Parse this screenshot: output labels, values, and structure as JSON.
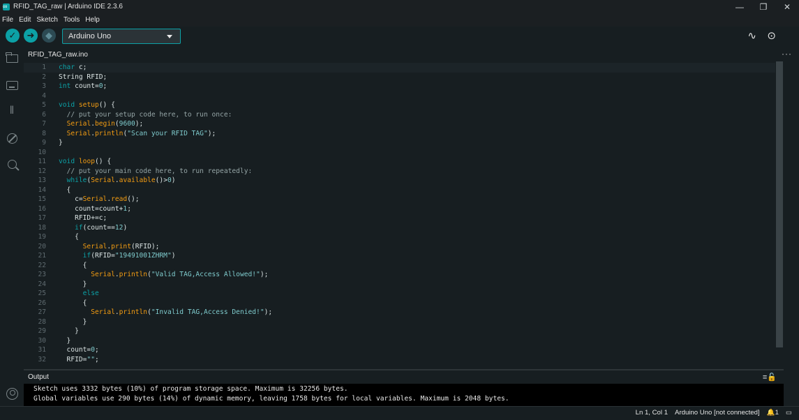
{
  "window": {
    "title": "RFID_TAG_raw | Arduino IDE 2.3.6",
    "controls": [
      "—",
      "❐",
      "✕"
    ]
  },
  "menu": [
    "File",
    "Edit",
    "Sketch",
    "Tools",
    "Help"
  ],
  "toolbar": {
    "verify_icon": "✓",
    "upload_icon": "➜",
    "debug_icon": "◆",
    "board": "Arduino Uno",
    "plotter_icon": "∿",
    "monitor_icon": "⊙"
  },
  "tab": {
    "filename": "RFID_TAG_raw.ino",
    "more": "···"
  },
  "code_lines": [
    {
      "n": "1",
      "tokens": [
        {
          "t": "kw",
          "v": "char"
        },
        {
          "t": "",
          "v": " c;"
        }
      ]
    },
    {
      "n": "2",
      "tokens": [
        {
          "t": "",
          "v": "String RFID;"
        }
      ]
    },
    {
      "n": "3",
      "tokens": [
        {
          "t": "kw",
          "v": "int"
        },
        {
          "t": "",
          "v": " count="
        },
        {
          "t": "num",
          "v": "0"
        },
        {
          "t": "",
          "v": ";"
        }
      ]
    },
    {
      "n": "4",
      "tokens": []
    },
    {
      "n": "5",
      "tokens": [
        {
          "t": "kw",
          "v": "void"
        },
        {
          "t": "",
          "v": " "
        },
        {
          "t": "fn",
          "v": "setup"
        },
        {
          "t": "",
          "v": "() {"
        }
      ]
    },
    {
      "n": "6",
      "tokens": [
        {
          "t": "",
          "v": "  "
        },
        {
          "t": "cm",
          "v": "// put your setup code here, to run once:"
        }
      ]
    },
    {
      "n": "7",
      "tokens": [
        {
          "t": "",
          "v": "  "
        },
        {
          "t": "fn",
          "v": "Serial"
        },
        {
          "t": "",
          "v": "."
        },
        {
          "t": "fn",
          "v": "begin"
        },
        {
          "t": "",
          "v": "("
        },
        {
          "t": "num",
          "v": "9600"
        },
        {
          "t": "",
          "v": ");"
        }
      ]
    },
    {
      "n": "8",
      "tokens": [
        {
          "t": "",
          "v": "  "
        },
        {
          "t": "fn",
          "v": "Serial"
        },
        {
          "t": "",
          "v": "."
        },
        {
          "t": "fn",
          "v": "println"
        },
        {
          "t": "",
          "v": "("
        },
        {
          "t": "str",
          "v": "\"Scan your RFID TAG\""
        },
        {
          "t": "",
          "v": ");"
        }
      ]
    },
    {
      "n": "9",
      "tokens": [
        {
          "t": "",
          "v": "}"
        }
      ]
    },
    {
      "n": "10",
      "tokens": []
    },
    {
      "n": "11",
      "tokens": [
        {
          "t": "kw",
          "v": "void"
        },
        {
          "t": "",
          "v": " "
        },
        {
          "t": "fn",
          "v": "loop"
        },
        {
          "t": "",
          "v": "() {"
        }
      ]
    },
    {
      "n": "12",
      "tokens": [
        {
          "t": "",
          "v": "  "
        },
        {
          "t": "cm",
          "v": "// put your main code here, to run repeatedly:"
        }
      ]
    },
    {
      "n": "13",
      "tokens": [
        {
          "t": "",
          "v": "  "
        },
        {
          "t": "kw",
          "v": "while"
        },
        {
          "t": "",
          "v": "("
        },
        {
          "t": "fn",
          "v": "Serial"
        },
        {
          "t": "",
          "v": "."
        },
        {
          "t": "fn",
          "v": "available"
        },
        {
          "t": "",
          "v": "()>"
        },
        {
          "t": "num",
          "v": "0"
        },
        {
          "t": "",
          "v": ")"
        }
      ]
    },
    {
      "n": "14",
      "tokens": [
        {
          "t": "",
          "v": "  {"
        }
      ]
    },
    {
      "n": "15",
      "tokens": [
        {
          "t": "",
          "v": "    c="
        },
        {
          "t": "fn",
          "v": "Serial"
        },
        {
          "t": "",
          "v": "."
        },
        {
          "t": "fn",
          "v": "read"
        },
        {
          "t": "",
          "v": "();"
        }
      ]
    },
    {
      "n": "16",
      "tokens": [
        {
          "t": "",
          "v": "    count=count+"
        },
        {
          "t": "num",
          "v": "1"
        },
        {
          "t": "",
          "v": ";"
        }
      ]
    },
    {
      "n": "17",
      "tokens": [
        {
          "t": "",
          "v": "    RFID+=c;"
        }
      ]
    },
    {
      "n": "18",
      "tokens": [
        {
          "t": "",
          "v": "    "
        },
        {
          "t": "kw",
          "v": "if"
        },
        {
          "t": "",
          "v": "(count=="
        },
        {
          "t": "num",
          "v": "12"
        },
        {
          "t": "",
          "v": ")"
        }
      ]
    },
    {
      "n": "19",
      "tokens": [
        {
          "t": "",
          "v": "    {"
        }
      ]
    },
    {
      "n": "20",
      "tokens": [
        {
          "t": "",
          "v": "      "
        },
        {
          "t": "fn",
          "v": "Serial"
        },
        {
          "t": "",
          "v": "."
        },
        {
          "t": "fn",
          "v": "print"
        },
        {
          "t": "",
          "v": "(RFID);"
        }
      ]
    },
    {
      "n": "21",
      "tokens": [
        {
          "t": "",
          "v": "      "
        },
        {
          "t": "kw",
          "v": "if"
        },
        {
          "t": "",
          "v": "(RFID="
        },
        {
          "t": "str",
          "v": "\"19491001ZHRM\""
        },
        {
          "t": "",
          "v": ")"
        }
      ]
    },
    {
      "n": "22",
      "tokens": [
        {
          "t": "",
          "v": "      {"
        }
      ]
    },
    {
      "n": "23",
      "tokens": [
        {
          "t": "",
          "v": "        "
        },
        {
          "t": "fn",
          "v": "Serial"
        },
        {
          "t": "",
          "v": "."
        },
        {
          "t": "fn",
          "v": "println"
        },
        {
          "t": "",
          "v": "("
        },
        {
          "t": "str",
          "v": "\"Valid TAG,Access Allowed!\""
        },
        {
          "t": "",
          "v": ");"
        }
      ]
    },
    {
      "n": "24",
      "tokens": [
        {
          "t": "",
          "v": "      }"
        }
      ]
    },
    {
      "n": "25",
      "tokens": [
        {
          "t": "",
          "v": "      "
        },
        {
          "t": "kw",
          "v": "else"
        }
      ]
    },
    {
      "n": "26",
      "tokens": [
        {
          "t": "",
          "v": "      {"
        }
      ]
    },
    {
      "n": "27",
      "tokens": [
        {
          "t": "",
          "v": "        "
        },
        {
          "t": "fn",
          "v": "Serial"
        },
        {
          "t": "",
          "v": "."
        },
        {
          "t": "fn",
          "v": "println"
        },
        {
          "t": "",
          "v": "("
        },
        {
          "t": "str",
          "v": "\"Invalid TAG,Access Denied!\""
        },
        {
          "t": "",
          "v": ");"
        }
      ]
    },
    {
      "n": "28",
      "tokens": [
        {
          "t": "",
          "v": "      }"
        }
      ]
    },
    {
      "n": "29",
      "tokens": [
        {
          "t": "",
          "v": "    }"
        }
      ]
    },
    {
      "n": "30",
      "tokens": [
        {
          "t": "",
          "v": "  }"
        }
      ]
    },
    {
      "n": "31",
      "tokens": [
        {
          "t": "",
          "v": "  count="
        },
        {
          "t": "num",
          "v": "0"
        },
        {
          "t": "",
          "v": ";"
        }
      ]
    },
    {
      "n": "32",
      "tokens": [
        {
          "t": "",
          "v": "  RFID="
        },
        {
          "t": "str",
          "v": "\"\""
        },
        {
          "t": "",
          "v": ";"
        }
      ]
    }
  ],
  "output": {
    "title": "Output",
    "icons": "≡🔓",
    "lines": [
      "Sketch uses 3332 bytes (10%) of program storage space. Maximum is 32256 bytes.",
      "Global variables use 290 bytes (14%) of dynamic memory, leaving 1758 bytes for local variables. Maximum is 2048 bytes."
    ]
  },
  "status": {
    "position": "Ln 1, Col 1",
    "board": "Arduino Uno [not connected]",
    "notifications": "🔔1",
    "panel_icon": "▭"
  }
}
